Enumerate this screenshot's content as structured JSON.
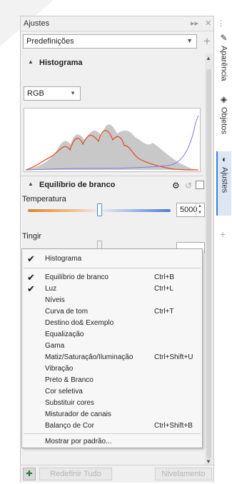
{
  "panel": {
    "title": "Ajustes",
    "preset_value": "Predefinições"
  },
  "histogram": {
    "header": "Histograma",
    "channel": "RGB"
  },
  "white_balance": {
    "header": "Equilíbrio de branco",
    "temperature_label": "Temperatura",
    "temperature_value": "5000",
    "temperature_level": 0.5,
    "tint_label": "Tingir"
  },
  "side_tabs": {
    "tab1": "Aparência",
    "tab2": "Objetos",
    "tab3": "Ajustes"
  },
  "bottom": {
    "reset_label": "Redefinir Tudo",
    "level_label": "Nivelamento"
  },
  "menu": {
    "items": [
      {
        "label": "Histograma",
        "shortcut": "",
        "checked": true
      },
      {
        "label": "Equilíbrio de branco",
        "shortcut": "Ctrl+B",
        "checked": true
      },
      {
        "label": "Luz",
        "shortcut": "Ctrl+L",
        "checked": true
      },
      {
        "label": "Níveis",
        "shortcut": "",
        "checked": false
      },
      {
        "label": "Curva de tom",
        "shortcut": "Ctrl+T",
        "checked": false
      },
      {
        "label": "Destino do& Exemplo",
        "shortcut": "",
        "checked": false
      },
      {
        "label": "Equalização",
        "shortcut": "",
        "checked": false
      },
      {
        "label": "Gama",
        "shortcut": "",
        "checked": false
      },
      {
        "label": "Matiz/Saturação/Iluminação",
        "shortcut": "Ctrl+Shift+U",
        "checked": false
      },
      {
        "label": "Vibração",
        "shortcut": "",
        "checked": false
      },
      {
        "label": "Preto & Branco",
        "shortcut": "",
        "checked": false
      },
      {
        "label": "Cor seletiva",
        "shortcut": "",
        "checked": false
      },
      {
        "label": "Substituir cores",
        "shortcut": "",
        "checked": false
      },
      {
        "label": "Misturador de canais",
        "shortcut": "",
        "checked": false
      },
      {
        "label": "Balanço de Cor",
        "shortcut": "Ctrl+Shift+B",
        "checked": false
      }
    ],
    "footer_label": "Mostrar por padrão..."
  },
  "icons": {
    "checkmark": "checkmark-icon",
    "collapse": "collapse-chevron-icon",
    "gear": "gear-icon",
    "reset": "reset-icon",
    "add": "plus-icon",
    "dropdown": "chevron-down-icon"
  },
  "colors": {
    "accent": "#3e7fd6",
    "histogram_red": "#d9542a",
    "histogram_fill": "#c8c8c8"
  }
}
